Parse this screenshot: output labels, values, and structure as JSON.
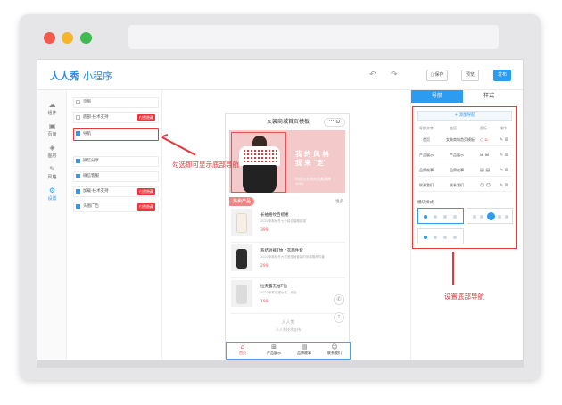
{
  "app": {
    "logo": "人人秀",
    "logo_sub": "小程序"
  },
  "header": {
    "undo": "↶",
    "redo": "↷",
    "save_label": "保存",
    "preview_label": "预览",
    "publish_label": "发布"
  },
  "leftnav": [
    {
      "icon": "☁",
      "label": "组件"
    },
    {
      "icon": "▣",
      "label": "页面"
    },
    {
      "icon": "◈",
      "label": "图层"
    },
    {
      "icon": "✎",
      "label": "风格"
    },
    {
      "icon": "⚙",
      "label": "设置"
    }
  ],
  "components": [
    {
      "label": "页眉",
      "checked": false,
      "badge": ""
    },
    {
      "label": "底部-技术支持",
      "checked": false,
      "badge": "付费隐藏"
    },
    {
      "label": "导航",
      "checked": true,
      "badge": ""
    },
    {
      "label": "微信分享",
      "checked": true,
      "badge": ""
    },
    {
      "label": "微信客服",
      "checked": true,
      "badge": ""
    },
    {
      "label": "加载-技术支持",
      "checked": true,
      "badge": "付费隐藏"
    },
    {
      "label": "头图广告",
      "checked": true,
      "badge": "付费隐藏"
    }
  ],
  "phone": {
    "title": "女装商城首页模板",
    "capsule": "··· ⊙",
    "banner_line1": "我 的 风 格",
    "banner_line2": "我 来 \"定\"",
    "banner_line3": "时尚与艺术的完美演绎",
    "banner_line4": "2020",
    "section_tag": "热卖产品",
    "section_more": "更多",
    "products": [
      {
        "name": "长袖格纹百褶裙",
        "desc": "2020新款秋冬七分袖百褶格纹裙",
        "price": "399"
      },
      {
        "name": "系结短裤T恤上衣两件套",
        "desc": "2020新款秋冬大衣宽垫肩套装时尚棉服两件套",
        "price": "299"
      },
      {
        "name": "拉夫露无袖T恤",
        "desc": "2020新款百搭女装、无袖",
        "price": "199"
      }
    ],
    "footer_logo": "人人秀",
    "footer_sub": "人人秀技术支持",
    "tabs": [
      {
        "icon": "⌂",
        "label": "首页"
      },
      {
        "icon": "⊞",
        "label": "产品展示"
      },
      {
        "icon": "▤",
        "label": "品牌故事"
      },
      {
        "icon": "☺",
        "label": "联系我们"
      }
    ]
  },
  "rightpanel": {
    "tab_nav": "导航",
    "tab_style": "样式",
    "add_nav": "+ 添加导航",
    "columns": [
      "导航文字",
      "链接",
      "图标",
      "操作"
    ],
    "rows": [
      {
        "text": "首页",
        "link": "女装商城首页模板",
        "icon": "◇ ⌂"
      },
      {
        "text": "产品展示",
        "link": "产品展示",
        "icon": "⊞ ⊞"
      },
      {
        "text": "品牌故事",
        "link": "品牌故事",
        "icon": "▤ ▤"
      },
      {
        "text": "联系我们",
        "link": "联系我们",
        "icon": "☺ ☺"
      }
    ],
    "ops": "✎ ⊠",
    "style_label": "模块样式"
  },
  "annotations": {
    "left": "勾选即可显示底部导航",
    "right": "设置底部导航"
  },
  "colors": {
    "accent": "#2d9cf0",
    "annotation": "#e8353a",
    "badge": "#f0323c"
  }
}
